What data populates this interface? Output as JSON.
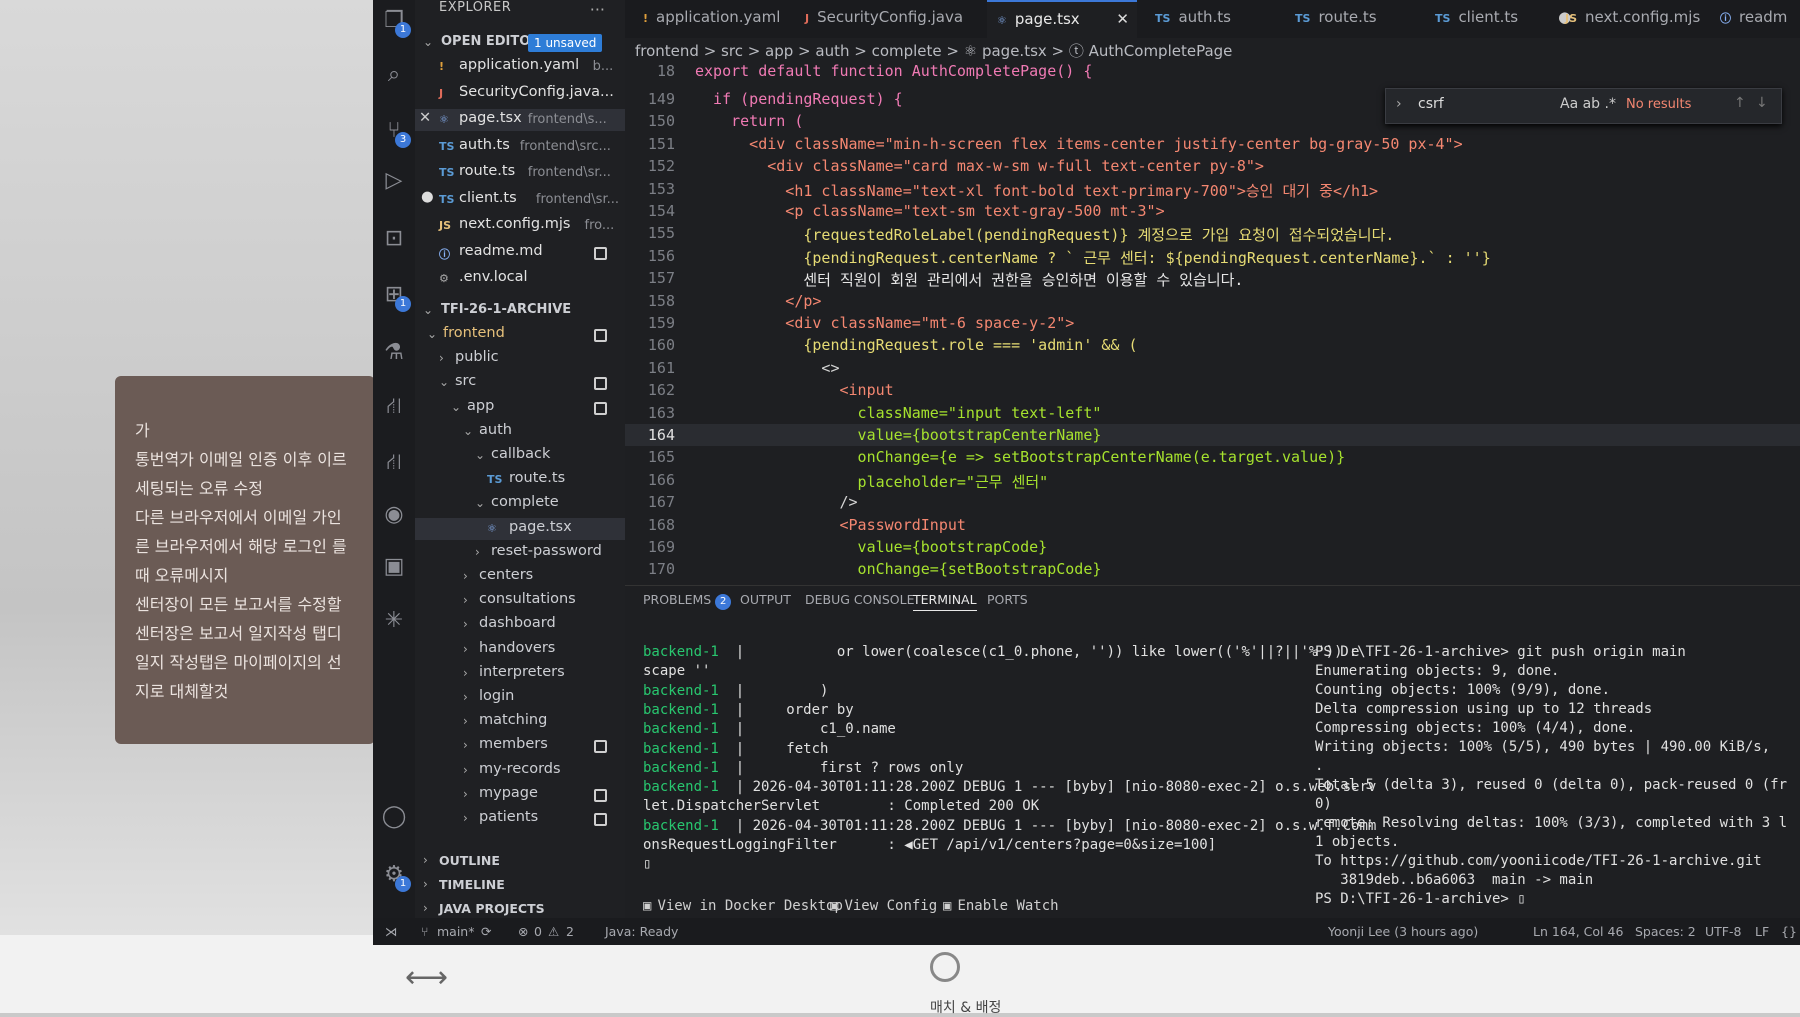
{
  "desktop": {
    "note_lines": [
      "가",
      "통번역가 이메일 인증 이후 이르",
      "세팅되는 오류 수정",
      "다른 브라우저에서 이메일 가인",
      "른 브라우저에서 해당 로그인 를",
      "때 오류메시지",
      "센터장이 모든 보고서를 수정할",
      "센터장은 보고서 일지작성 탭디",
      "일지 작성탭은 마이페이지의 선",
      "지로 대체할것"
    ],
    "bottom_label": "매치 & 배정"
  },
  "activity_bar": {
    "icons": [
      {
        "name": "files-icon",
        "badge": "1"
      },
      {
        "name": "search-icon",
        "badge": ""
      },
      {
        "name": "source-control-icon",
        "badge": "3"
      },
      {
        "name": "run-debug-icon",
        "badge": ""
      },
      {
        "name": "remote-explorer-icon",
        "badge": ""
      },
      {
        "name": "extensions-icon",
        "badge": "1"
      },
      {
        "name": "testing-icon",
        "badge": ""
      },
      {
        "name": "git-graph-icon",
        "badge": ""
      },
      {
        "name": "git-lens-icon",
        "badge": ""
      },
      {
        "name": "github-icon",
        "badge": ""
      },
      {
        "name": "docker-icon",
        "badge": ""
      },
      {
        "name": "spark-icon",
        "badge": ""
      },
      {
        "name": "account-icon",
        "badge": ""
      },
      {
        "name": "settings-icon",
        "badge": "1"
      }
    ]
  },
  "explorer": {
    "title": "EXPLORER",
    "open_editors_label": "OPEN EDITORS",
    "unsaved_badge": "1 unsaved",
    "open_editors": [
      {
        "icon": "!",
        "name": "application.yaml",
        "path": "b..."
      },
      {
        "icon": "J",
        "name": "SecurityConfig.java...",
        "path": ""
      },
      {
        "icon": "⚛",
        "name": "page.tsx",
        "path": "frontend\\s..."
      },
      {
        "icon": "TS",
        "name": "auth.ts",
        "path": "frontend\\src..."
      },
      {
        "icon": "TS",
        "name": "route.ts",
        "path": "frontend\\sr..."
      },
      {
        "icon": "TS",
        "name": "client.ts",
        "path": "frontend\\sr..."
      },
      {
        "icon": "JS",
        "name": "next.config.mjs",
        "path": "fro..."
      },
      {
        "icon": "ⓘ",
        "name": "readme.md",
        "path": ""
      },
      {
        "icon": "⚙",
        "name": ".env.local",
        "path": ""
      }
    ],
    "workspace": "TFI-26-1-ARCHIVE",
    "tree": [
      {
        "label": "frontend",
        "indent": 0,
        "open": true
      },
      {
        "label": "public",
        "indent": 1,
        "open": false
      },
      {
        "label": "src",
        "indent": 1,
        "open": true
      },
      {
        "label": "app",
        "indent": 2,
        "open": true
      },
      {
        "label": "auth",
        "indent": 3,
        "open": true
      },
      {
        "label": "callback",
        "indent": 4,
        "open": true
      },
      {
        "label": "route.ts",
        "indent": 5,
        "file": "TS"
      },
      {
        "label": "complete",
        "indent": 4,
        "open": true
      },
      {
        "label": "page.tsx",
        "indent": 5,
        "file": "⚛"
      },
      {
        "label": "reset-password",
        "indent": 4,
        "open": false
      },
      {
        "label": "centers",
        "indent": 3,
        "open": false
      },
      {
        "label": "consultations",
        "indent": 3,
        "open": false
      },
      {
        "label": "dashboard",
        "indent": 3,
        "open": false
      },
      {
        "label": "handovers",
        "indent": 3,
        "open": false
      },
      {
        "label": "interpreters",
        "indent": 3,
        "open": false
      },
      {
        "label": "login",
        "indent": 3,
        "open": false
      },
      {
        "label": "matching",
        "indent": 3,
        "open": false
      },
      {
        "label": "members",
        "indent": 3,
        "open": false
      },
      {
        "label": "my-records",
        "indent": 3,
        "open": false
      },
      {
        "label": "mypage",
        "indent": 3,
        "open": false
      },
      {
        "label": "patients",
        "indent": 3,
        "open": false
      }
    ],
    "sections": [
      "OUTLINE",
      "TIMELINE",
      "JAVA PROJECTS"
    ]
  },
  "tabs": [
    {
      "icon": "!",
      "label": "application.yaml"
    },
    {
      "icon": "J",
      "label": "SecurityConfig.java"
    },
    {
      "icon": "⚛",
      "label": "page.tsx"
    },
    {
      "icon": "TS",
      "label": "auth.ts"
    },
    {
      "icon": "TS",
      "label": "route.ts"
    },
    {
      "icon": "TS",
      "label": "client.ts"
    },
    {
      "icon": "JS",
      "label": "next.config.mjs"
    },
    {
      "icon": "ⓘ",
      "label": "readm"
    }
  ],
  "breadcrumb": "frontend > src > app > auth > complete > ⚛ page.tsx > ⓣ AuthCompletePage",
  "sticky_line": {
    "number": "18",
    "text": "export default function AuthCompletePage() {"
  },
  "code_lines": [
    {
      "n": "149",
      "text": "  if (pendingRequest) {"
    },
    {
      "n": "150",
      "text": "    return ("
    },
    {
      "n": "151",
      "text": "      <div className=\"min-h-screen flex items-center justify-center bg-gray-50 px-4\">"
    },
    {
      "n": "152",
      "text": "        <div className=\"card max-w-sm w-full text-center py-8\">"
    },
    {
      "n": "153",
      "text": "          <h1 className=\"text-xl font-bold text-primary-700\">승인 대기 중</h1>"
    },
    {
      "n": "154",
      "text": "          <p className=\"text-sm text-gray-500 mt-3\">"
    },
    {
      "n": "155",
      "text": "            {requestedRoleLabel(pendingRequest)} 계정으로 가입 요청이 접수되었습니다."
    },
    {
      "n": "156",
      "text": "            {pendingRequest.centerName ? ` 근무 센터: ${pendingRequest.centerName}.` : ''}"
    },
    {
      "n": "157",
      "text": "            센터 직원이 회원 관리에서 권한을 승인하면 이용할 수 있습니다."
    },
    {
      "n": "158",
      "text": "          </p>"
    },
    {
      "n": "159",
      "text": "          <div className=\"mt-6 space-y-2\">"
    },
    {
      "n": "160",
      "text": "            {pendingRequest.role === 'admin' && ("
    },
    {
      "n": "161",
      "text": "              <>"
    },
    {
      "n": "162",
      "text": "                <input"
    },
    {
      "n": "163",
      "text": "                  className=\"input text-left\""
    },
    {
      "n": "164",
      "text": "                  value={bootstrapCenterName}"
    },
    {
      "n": "165",
      "text": "                  onChange={e => setBootstrapCenterName(e.target.value)}"
    },
    {
      "n": "166",
      "text": "                  placeholder=\"근무 센터\""
    },
    {
      "n": "167",
      "text": "                />"
    },
    {
      "n": "168",
      "text": "                <PasswordInput"
    },
    {
      "n": "169",
      "text": "                  value={bootstrapCode}"
    },
    {
      "n": "170",
      "text": "                  onChange={setBootstrapCode}"
    }
  ],
  "find_widget": {
    "query": "csrf",
    "options": "Aa  ab  .*",
    "result": "No results"
  },
  "panel": {
    "tabs": [
      "PROBLEMS",
      "OUTPUT",
      "DEBUG CONSOLE",
      "TERMINAL",
      "PORTS"
    ],
    "problems_count": "2",
    "left_terminal": [
      {
        "prefix": "backend-1",
        "text": "  |           or lower(coalesce(c1_0.phone, '')) like lower(('%'||?||'%')) e"
      },
      {
        "prefix": "",
        "text": "scape ''"
      },
      {
        "prefix": "backend-1",
        "text": "  |         )"
      },
      {
        "prefix": "backend-1",
        "text": "  |     order by"
      },
      {
        "prefix": "backend-1",
        "text": "  |         c1_0.name"
      },
      {
        "prefix": "backend-1",
        "text": "  |     fetch"
      },
      {
        "prefix": "backend-1",
        "text": "  |         first ? rows only"
      },
      {
        "prefix": "backend-1",
        "text": "  | 2026-04-30T01:11:28.200Z DEBUG 1 --- [byby] [nio-8080-exec-2] o.s.web.serv"
      },
      {
        "prefix": "",
        "text": "let.DispatcherServlet        : Completed 200 OK"
      },
      {
        "prefix": "backend-1",
        "text": "  | 2026-04-30T01:11:28.200Z DEBUG 1 --- [byby] [nio-8080-exec-2] o.s.w.f.Comm"
      },
      {
        "prefix": "",
        "text": "onsRequestLoggingFilter      : ◀GET /api/v1/centers?page=0&size=100]"
      },
      {
        "prefix": "",
        "text": "▯"
      }
    ],
    "left_footer": [
      "View in Docker Desktop",
      "View Config",
      "Enable Watch"
    ],
    "right_terminal": [
      "PS D:\\TFI-26-1-archive> git push origin main",
      "Enumerating objects: 9, done.",
      "Counting objects: 100% (9/9), done.",
      "Delta compression using up to 12 threads",
      "Compressing objects: 100% (4/4), done.",
      "Writing objects: 100% (5/5), 490 bytes | 490.00 KiB/s,",
      ".",
      "Total 5 (delta 3), reused 0 (delta 0), pack-reused 0 (fr",
      "0)",
      "remote: Resolving deltas: 100% (3/3), completed with 3 l",
      "1 objects.",
      "To https://github.com/yooniicode/TFI-26-1-archive.git",
      "   3819deb..b6a6063  main -> main",
      "PS D:\\TFI-26-1-archive> ▯"
    ]
  },
  "status_bar": {
    "branch": "main*",
    "errors": "0",
    "warnings": "2",
    "java": "Java: Ready",
    "blame": "Yoonji Lee (3 hours ago)",
    "position": "Ln 164, Col 46",
    "spaces": "Spaces: 2",
    "encoding": "UTF-8",
    "eol": "LF",
    "lang": "{}"
  }
}
